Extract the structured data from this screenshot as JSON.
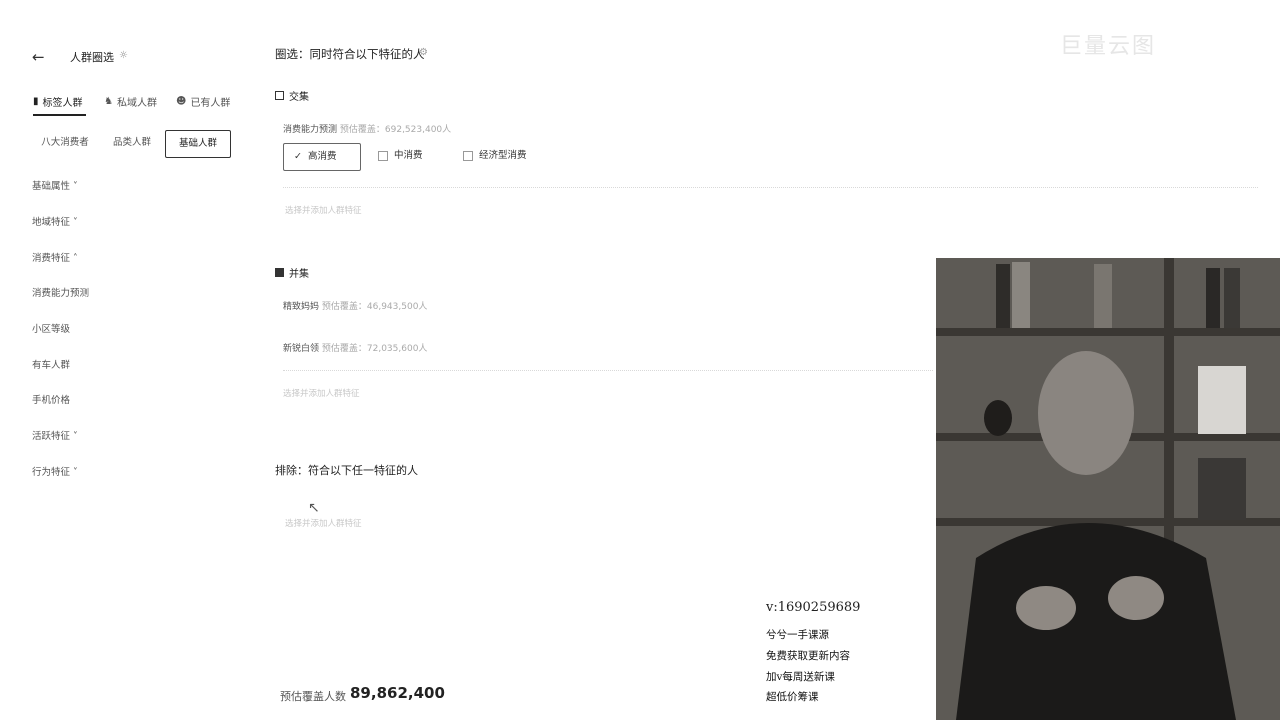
{
  "panel": {
    "title": "人群圈选",
    "segments": [
      {
        "label": "标签人群",
        "active": true
      },
      {
        "label": "私域人群",
        "active": false
      },
      {
        "label": "已有人群",
        "active": false
      }
    ],
    "subtabs": [
      {
        "label": "八大消费者",
        "active": false
      },
      {
        "label": "品类人群",
        "active": false
      },
      {
        "label": "基础人群",
        "active": true
      }
    ],
    "nav": [
      {
        "label": "基础属性 ˅"
      },
      {
        "label": "地域特征 ˅"
      },
      {
        "label": "消费特征 ˄"
      },
      {
        "label": "消费能力预测"
      },
      {
        "label": "小区等级"
      },
      {
        "label": "有车人群"
      },
      {
        "label": "手机价格"
      },
      {
        "label": "活跃特征 ˅"
      },
      {
        "label": "行为特征 ˅"
      }
    ]
  },
  "main": {
    "heading": "圈选：同时符合以下特征的人",
    "intersection": {
      "title": "交集",
      "rule_label": "消费能力预测",
      "rule_sub": "预估覆盖：692,523,400人",
      "options": [
        {
          "label": "高消费",
          "checked": true
        },
        {
          "label": "中消费",
          "checked": false
        },
        {
          "label": "经济型消费",
          "checked": false
        }
      ],
      "hint": "选择并添加人群特征"
    },
    "union": {
      "title": "并集",
      "items": [
        {
          "label": "精致妈妈",
          "sub": "预估覆盖：46,943,500人"
        },
        {
          "label": "新锐白领",
          "sub": "预估覆盖：72,035,600人"
        }
      ],
      "hint": "选择并添加人群特征"
    },
    "exclude": {
      "heading": "排除：符合以下任一特征的人",
      "hint": "选择并添加人群特征"
    },
    "footer": {
      "label": "预估覆盖人数",
      "count": "89,862,400"
    }
  },
  "overlay": {
    "contact": "v:1690259689",
    "lines": [
      "兮兮一手课源",
      "免费获取更新内容",
      "加v每周送新课",
      "超低价筹课"
    ]
  },
  "watermark": "巨量云图"
}
